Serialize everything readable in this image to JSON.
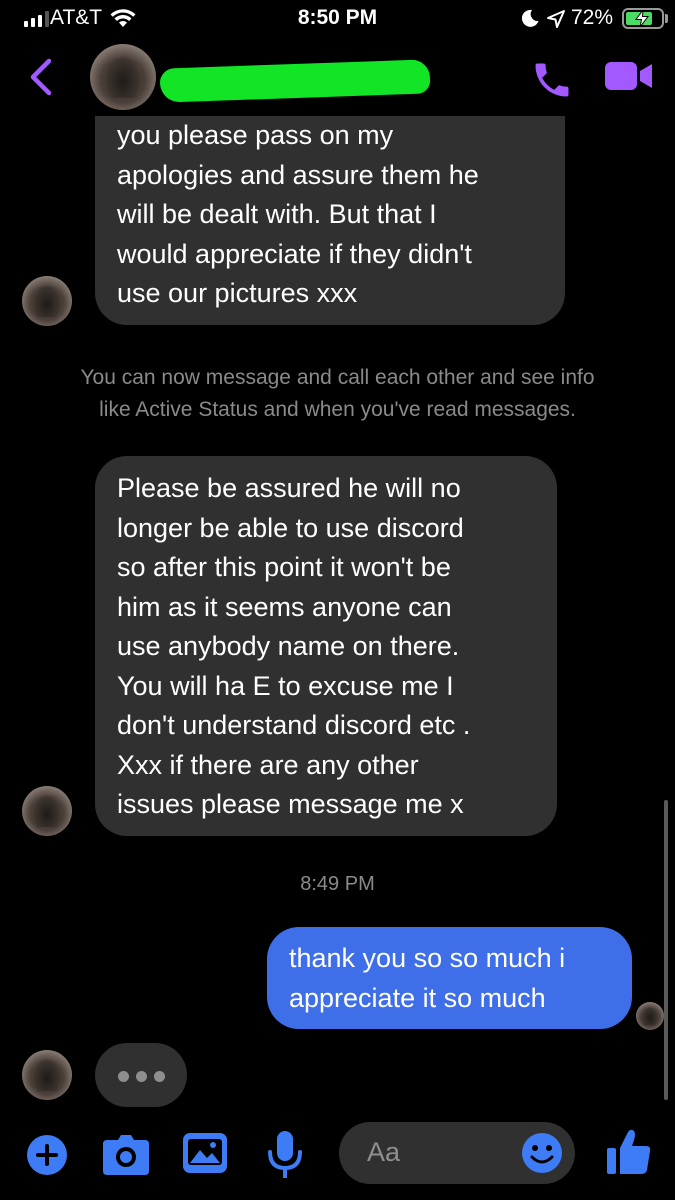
{
  "status_bar": {
    "carrier": "AT&T",
    "time": "8:50 PM",
    "battery_percent": "72%",
    "signal_bars": 3,
    "battery_level": 0.72,
    "charging": true
  },
  "header": {
    "contact_name": "",
    "contact_name_redacted": true,
    "accent_color": "#a259ff",
    "icons": [
      "back-chevron-icon",
      "phone-icon",
      "video-camera-icon"
    ]
  },
  "messages": {
    "incoming_1": {
      "lines": [
        "you please pass on my",
        "apologies and assure them he",
        "will be dealt with. But that I",
        "would appreciate if they didn't",
        "use our pictures xxx"
      ]
    },
    "system_note": {
      "lines": [
        "You can now message and call each other and see info",
        "like Active Status and when you've read messages."
      ]
    },
    "incoming_2": {
      "lines": [
        "Please be assured he will no",
        "longer be able to use discord",
        "so after this point it won't be",
        "him as it seems anyone can",
        "use anybody name on there.",
        "You will ha E to excuse me I",
        "don't understand discord etc .",
        "Xxx if there are any other",
        "issues please message me x"
      ]
    },
    "timestamp": "8:49 PM",
    "outgoing_1": {
      "lines": [
        "thank you so so much i",
        "appreciate it so much"
      ]
    },
    "typing_indicator": "..."
  },
  "composer": {
    "placeholder": "Aa",
    "icons": [
      "plus-icon",
      "camera-icon",
      "gallery-icon",
      "microphone-icon",
      "emoji-icon",
      "thumbs-up-icon"
    ],
    "accent_color": "#3d7cf5"
  },
  "colors": {
    "incoming_bubble": "#303030",
    "outgoing_bubble": "#3f6ee9",
    "background": "#000000",
    "secondary_text": "#8a8a8a"
  }
}
